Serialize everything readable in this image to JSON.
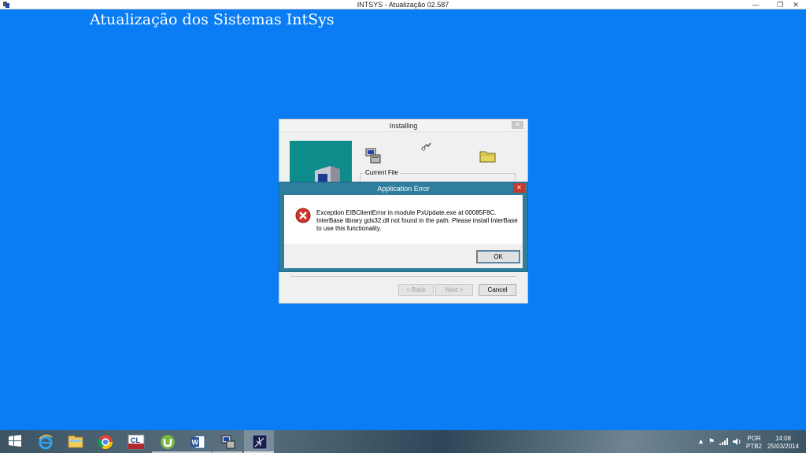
{
  "window": {
    "title": "INTSYS - Atualização 02.587",
    "minimize": "—",
    "maximize": "❐",
    "close": "✕"
  },
  "main": {
    "heading": "Atualização dos Sistemas IntSys"
  },
  "installing_dialog": {
    "title": "Installing",
    "close": "✕",
    "current_file_label": "Current File",
    "back_button": "< Back",
    "next_button": "Next >",
    "cancel_button": "Cancel"
  },
  "error_dialog": {
    "title": "Application Error",
    "close": "✕",
    "message_line1": "Exception EIBClientError in module PxUpdate.exe at 00085F8C.",
    "message_line2": "InterBase library gds32.dll not found in the path. Please install InterBase",
    "message_line3": "to use this functionality.",
    "ok_button": "OK",
    "icon": "error-icon"
  },
  "taskbar": {
    "items": [
      "windows-start",
      "internet-explorer",
      "file-explorer",
      "chrome",
      "cl-app",
      "utorrent",
      "word",
      "installer",
      "splash-app"
    ],
    "tray": {
      "chevron": "▲",
      "flag": "⚑",
      "lang_top": "POR",
      "lang_bottom": "PTB2",
      "time": "14:08",
      "date": "25/03/2014"
    }
  },
  "colors": {
    "desktop": "#0a7cf4",
    "error_frame": "#2f7e9d",
    "teal_panel": "#0e8b8b"
  }
}
